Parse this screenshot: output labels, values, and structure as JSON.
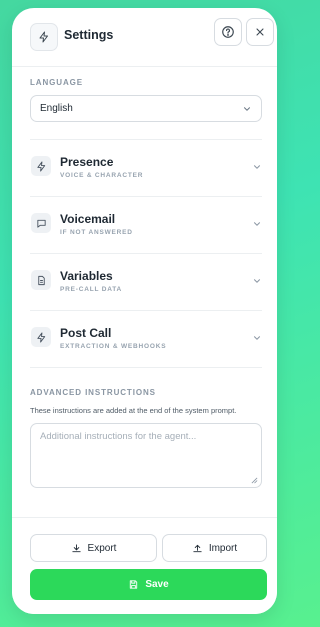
{
  "header": {
    "title": "Settings",
    "icon": "bolt-icon",
    "help_icon": "help-circle-icon",
    "close_icon": "close-icon"
  },
  "language": {
    "label": "LANGUAGE",
    "value": "English"
  },
  "sections": [
    {
      "title": "Presence",
      "subtitle": "VOICE & CHARACTER",
      "icon": "bolt-icon"
    },
    {
      "title": "Voicemail",
      "subtitle": "IF NOT ANSWERED",
      "icon": "message-icon"
    },
    {
      "title": "Variables",
      "subtitle": "PRE-CALL DATA",
      "icon": "document-icon"
    },
    {
      "title": "Post Call",
      "subtitle": "EXTRACTION & WEBHOOKS",
      "icon": "bolt-icon"
    }
  ],
  "advanced": {
    "label": "ADVANCED INSTRUCTIONS",
    "description": "These instructions are added at the end of the system prompt.",
    "placeholder": "Additional instructions for the agent...",
    "value": ""
  },
  "footer": {
    "export_label": "Export",
    "import_label": "Import",
    "save_label": "Save"
  },
  "colors": {
    "save_button": "#2cd95a",
    "background_gradient_start": "#45d8a0",
    "background_gradient_end": "#58f08f"
  }
}
